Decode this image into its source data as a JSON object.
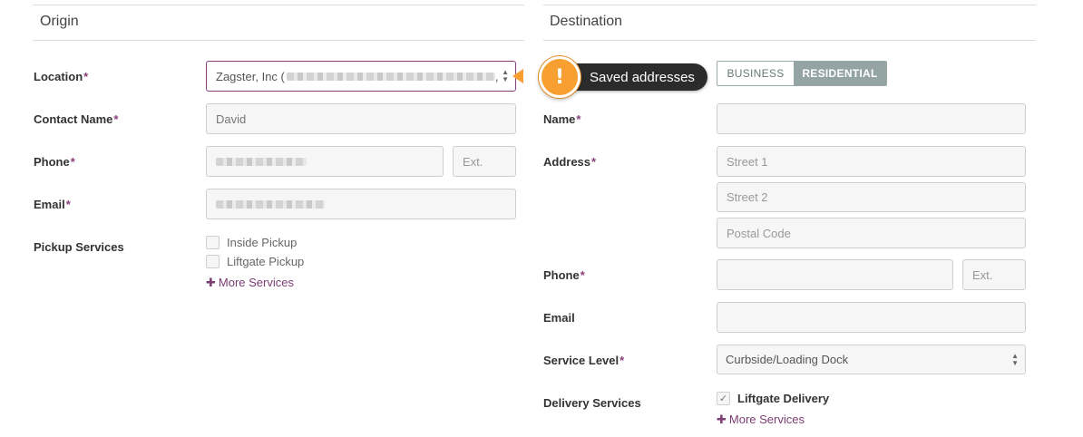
{
  "origin": {
    "title": "Origin",
    "location": {
      "label": "Location",
      "required": "*",
      "value": "Zagster, Inc ("
    },
    "contact_name": {
      "label": "Contact Name",
      "required": "*",
      "value": "David"
    },
    "phone": {
      "label": "Phone",
      "required": "*",
      "ext_placeholder": "Ext."
    },
    "email": {
      "label": "Email",
      "required": "*"
    },
    "pickup_services": {
      "label": "Pickup Services",
      "options": [
        {
          "label": "Inside Pickup",
          "checked": false
        },
        {
          "label": "Liftgate Pickup",
          "checked": false
        }
      ],
      "more": "More Services"
    }
  },
  "tooltip": {
    "text": "Saved addresses",
    "icon": "exclamation-icon"
  },
  "destination": {
    "title": "Destination",
    "type_toggle": {
      "business": "BUSINESS",
      "residential": "RESIDENTIAL",
      "selected": "RESIDENTIAL"
    },
    "name": {
      "label": "Name",
      "required": "*"
    },
    "address": {
      "label": "Address",
      "required": "*",
      "street1_placeholder": "Street 1",
      "street2_placeholder": "Street 2",
      "postal_placeholder": "Postal Code"
    },
    "phone": {
      "label": "Phone",
      "required": "*",
      "ext_placeholder": "Ext."
    },
    "email": {
      "label": "Email"
    },
    "service_level": {
      "label": "Service Level",
      "required": "*",
      "value": "Curbside/Loading Dock"
    },
    "delivery_services": {
      "label": "Delivery Services",
      "options": [
        {
          "label": "Liftgate Delivery",
          "checked": true
        }
      ],
      "more": "More Services"
    }
  },
  "colors": {
    "accent": "#8a3f7a",
    "tooltip_orange": "#f7a031",
    "toggle_selected": "#94a4a2"
  }
}
